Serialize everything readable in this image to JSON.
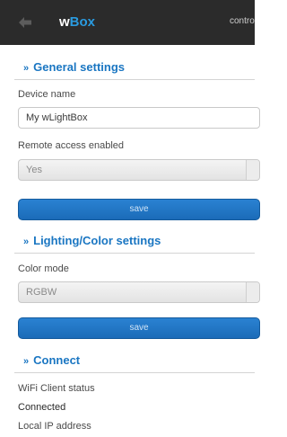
{
  "header": {
    "brand_prefix": "w",
    "brand_accent": "Box",
    "nav_item": "control"
  },
  "general": {
    "title": "General settings",
    "device_name_label": "Device name",
    "device_name_value": "My wLightBox",
    "remote_access_label": "Remote access enabled",
    "remote_access_value": "Yes",
    "save_label": "save"
  },
  "lighting": {
    "title": "Lighting/Color settings",
    "color_mode_label": "Color mode",
    "color_mode_value": "RGBW",
    "save_label": "save"
  },
  "connect": {
    "title": "Connect",
    "wifi_status_label": "WiFi Client status",
    "wifi_status_value": "Connected",
    "local_ip_label": "Local IP address"
  },
  "icons": {
    "back": "arrow-left-icon",
    "section": "double-chevron-icon",
    "dropdown": "dropdown-caret"
  },
  "colors": {
    "topbar": "#2b2b2b",
    "accent": "#2a9be0",
    "section_title": "#1a76c2",
    "button": "#1b6bb8"
  }
}
